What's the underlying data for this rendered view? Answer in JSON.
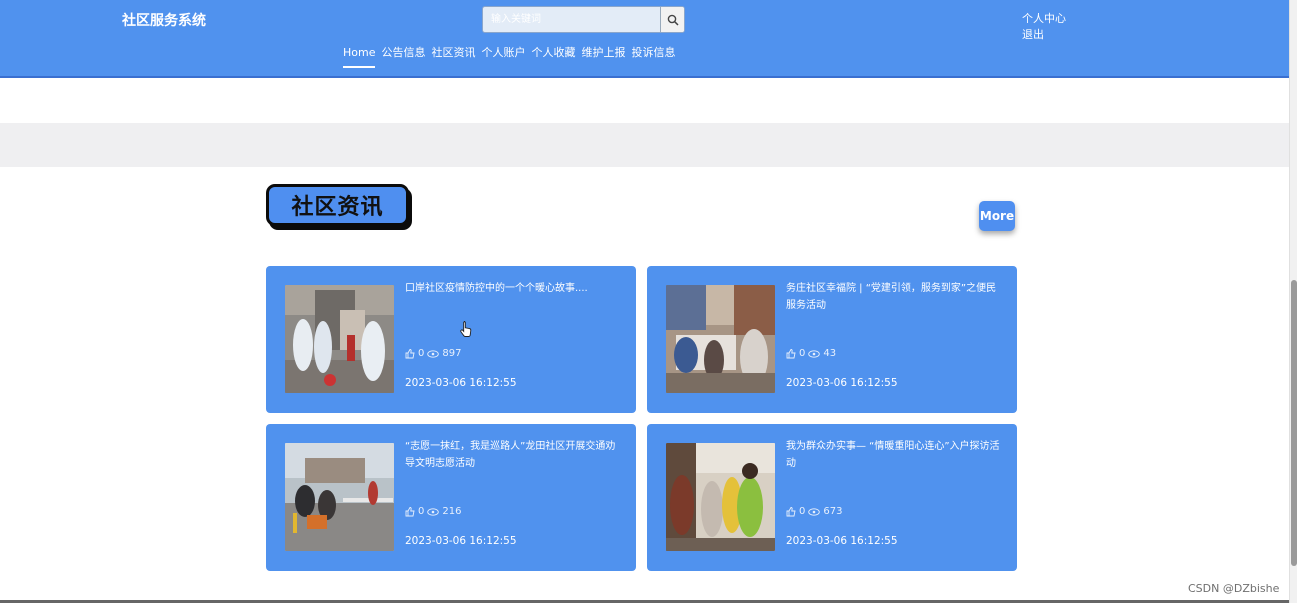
{
  "header": {
    "site_title": "社区服务系统",
    "search_placeholder": "输入关键词",
    "nav": [
      "Home",
      "公告信息",
      "社区资讯",
      "个人账户",
      "个人收藏",
      "维护上报",
      "投诉信息"
    ],
    "user_links": [
      "个人中心",
      "退出"
    ]
  },
  "section": {
    "title": "社区资讯",
    "more_label": "More"
  },
  "cards": [
    {
      "title": "口岸社区疫情防控中的一个个暖心故事....",
      "likes": "0",
      "views": "897",
      "date": "2023-03-06 16:12:55"
    },
    {
      "title": "务庄社区幸福院 | “党建引领，服务到家”之便民服务活动",
      "likes": "0",
      "views": "43",
      "date": "2023-03-06 16:12:55"
    },
    {
      "title": "“志愿一抹红，我是巡路人”龙田社区开展交通劝导文明志愿活动",
      "likes": "0",
      "views": "216",
      "date": "2023-03-06 16:12:55"
    },
    {
      "title": "我为群众办实事— “情暖重阳心连心”入户探访活动",
      "likes": "0",
      "views": "673",
      "date": "2023-03-06 16:12:55"
    }
  ],
  "watermark": "CSDN @DZbishe",
  "colors": {
    "primary": "#5092ee",
    "band": "#efeff1"
  }
}
